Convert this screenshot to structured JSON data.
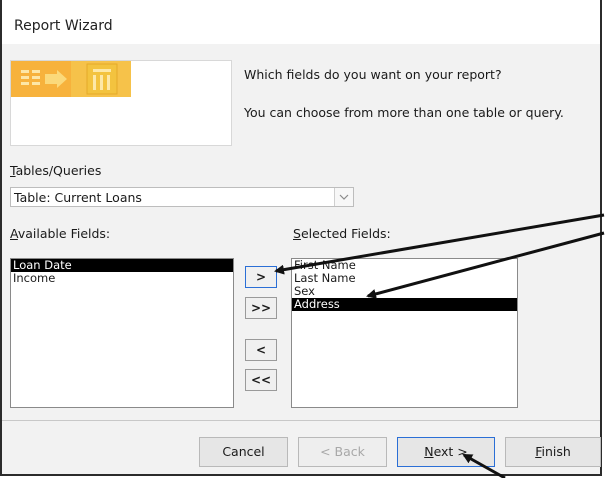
{
  "window": {
    "title": "Report Wizard"
  },
  "prompt": {
    "line1": "Which fields do you want on your report?",
    "line2": "You can choose from more than one table or query."
  },
  "tables_queries": {
    "label_accel": "T",
    "label_rest": "ables/Queries",
    "selected": "Table: Current Loans",
    "dropdown_icon": "chevron-down-icon"
  },
  "available": {
    "label_accel": "A",
    "label_rest": "vailable Fields:",
    "items": [
      "Loan Date",
      "Income"
    ],
    "selected_index": 0
  },
  "selected_fields": {
    "label_accel": "S",
    "label_rest": "elected Fields:",
    "items": [
      "First Name",
      "Last Name",
      "Sex",
      "Address"
    ],
    "selected_index": 3
  },
  "move_buttons": {
    "add": ">",
    "add_all": ">>",
    "remove": "<",
    "remove_all": "<<"
  },
  "footer": {
    "cancel": "Cancel",
    "back": "< Back",
    "back_accel": "B",
    "next": "Next >",
    "next_accel": "N",
    "finish": "Finish",
    "finish_accel": "F"
  },
  "colors": {
    "selection_bg": "#000000",
    "selection_fg": "#ffffff",
    "focus_border": "#2b6fd6",
    "wizard_icon_orange": "#f5b53a",
    "wizard_icon_yellow": "#f7d04a",
    "annotation_arrow": "#111111"
  }
}
